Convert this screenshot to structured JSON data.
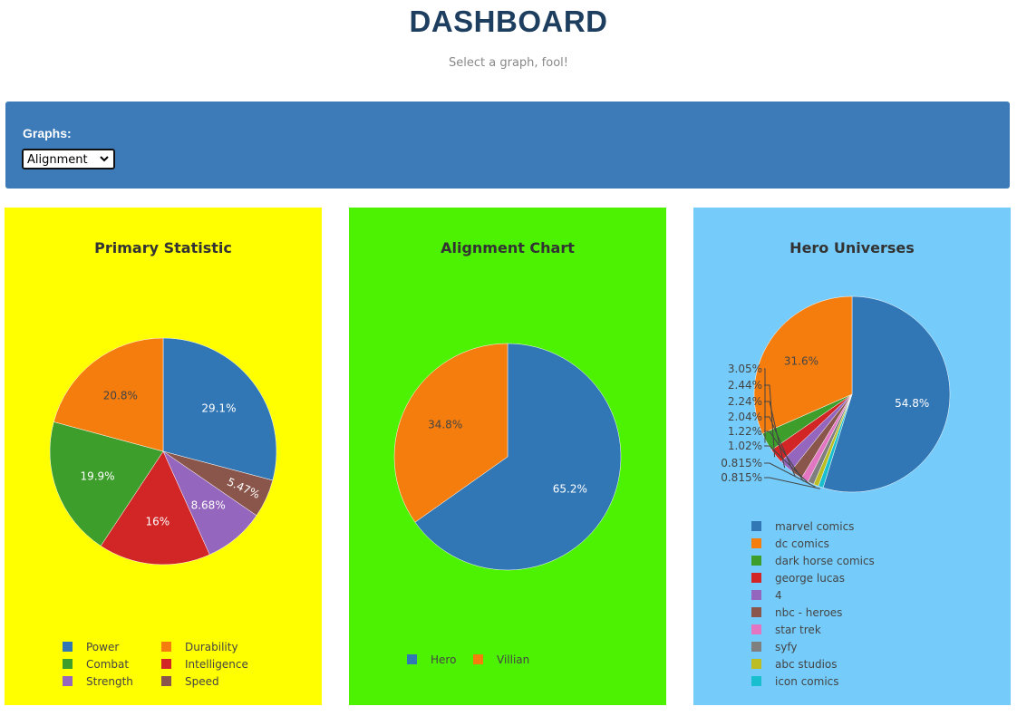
{
  "header": {
    "title": "DASHBOARD",
    "subtitle": "Select a graph, fool!"
  },
  "controls": {
    "label": "Graphs:",
    "selected": "Alignment"
  },
  "colors": {
    "panel1_bg": "#ffff00",
    "panel2_bg": "#4cf202",
    "panel3_bg": "#75ccfb",
    "controls_bg": "#3d7ab8"
  },
  "chart_data": [
    {
      "type": "pie",
      "title": "Primary Statistic",
      "legend": "bottom",
      "slices": [
        {
          "label": "Power",
          "value": 29.1,
          "text": "29.1%",
          "color": "#3176b5"
        },
        {
          "label": "Speed",
          "value": 5.47,
          "text": "5.47%",
          "color": "#8a564b"
        },
        {
          "label": "Strength",
          "value": 8.68,
          "text": "8.68%",
          "color": "#9466bd"
        },
        {
          "label": "Intelligence",
          "value": 16,
          "text": "16%",
          "color": "#d22626"
        },
        {
          "label": "Combat",
          "value": 19.9,
          "text": "19.9%",
          "color": "#3d9e2c"
        },
        {
          "label": "Durability",
          "value": 20.8,
          "text": "20.8%",
          "color": "#f57d0e"
        }
      ],
      "legend_order": [
        "Power",
        "Durability",
        "Combat",
        "Intelligence",
        "Strength",
        "Speed"
      ]
    },
    {
      "type": "pie",
      "title": "Alignment Chart",
      "legend": "bottom",
      "slices": [
        {
          "label": "Hero",
          "value": 65.2,
          "text": "65.2%",
          "color": "#3176b5"
        },
        {
          "label": "Villian",
          "value": 34.8,
          "text": "34.8%",
          "color": "#f57d0e"
        }
      ],
      "legend_order": [
        "Hero",
        "Villian"
      ]
    },
    {
      "type": "pie",
      "title": "Hero Universes",
      "legend": "bottom",
      "slices": [
        {
          "label": "marvel comics",
          "value": 54.8,
          "text": "54.8%",
          "color": "#3176b5"
        },
        {
          "label": "icon comics",
          "value": 0.815,
          "text": "0.815%",
          "color": "#19bfcf"
        },
        {
          "label": "abc studios",
          "value": 0.815,
          "text": "0.815%",
          "color": "#bcbd22"
        },
        {
          "label": "syfy",
          "value": 1.02,
          "text": "1.02%",
          "color": "#7f7f7f"
        },
        {
          "label": "star trek",
          "value": 1.22,
          "text": "1.22%",
          "color": "#e376c2"
        },
        {
          "label": "nbc - heroes",
          "value": 2.04,
          "text": "2.04%",
          "color": "#8a564b"
        },
        {
          "label": "4",
          "value": 2.24,
          "text": "2.24%",
          "color": "#9466bd"
        },
        {
          "label": "george lucas",
          "value": 2.44,
          "text": "2.44%",
          "color": "#d22626"
        },
        {
          "label": "dark horse comics",
          "value": 3.05,
          "text": "3.05%",
          "color": "#3d9e2c"
        },
        {
          "label": "dc comics",
          "value": 31.6,
          "text": "31.6%",
          "color": "#f57d0e"
        }
      ],
      "legend_order": [
        "marvel comics",
        "dc comics",
        "dark horse comics",
        "george lucas",
        "4",
        "nbc - heroes",
        "star trek",
        "syfy",
        "abc studios",
        "icon comics"
      ]
    }
  ]
}
